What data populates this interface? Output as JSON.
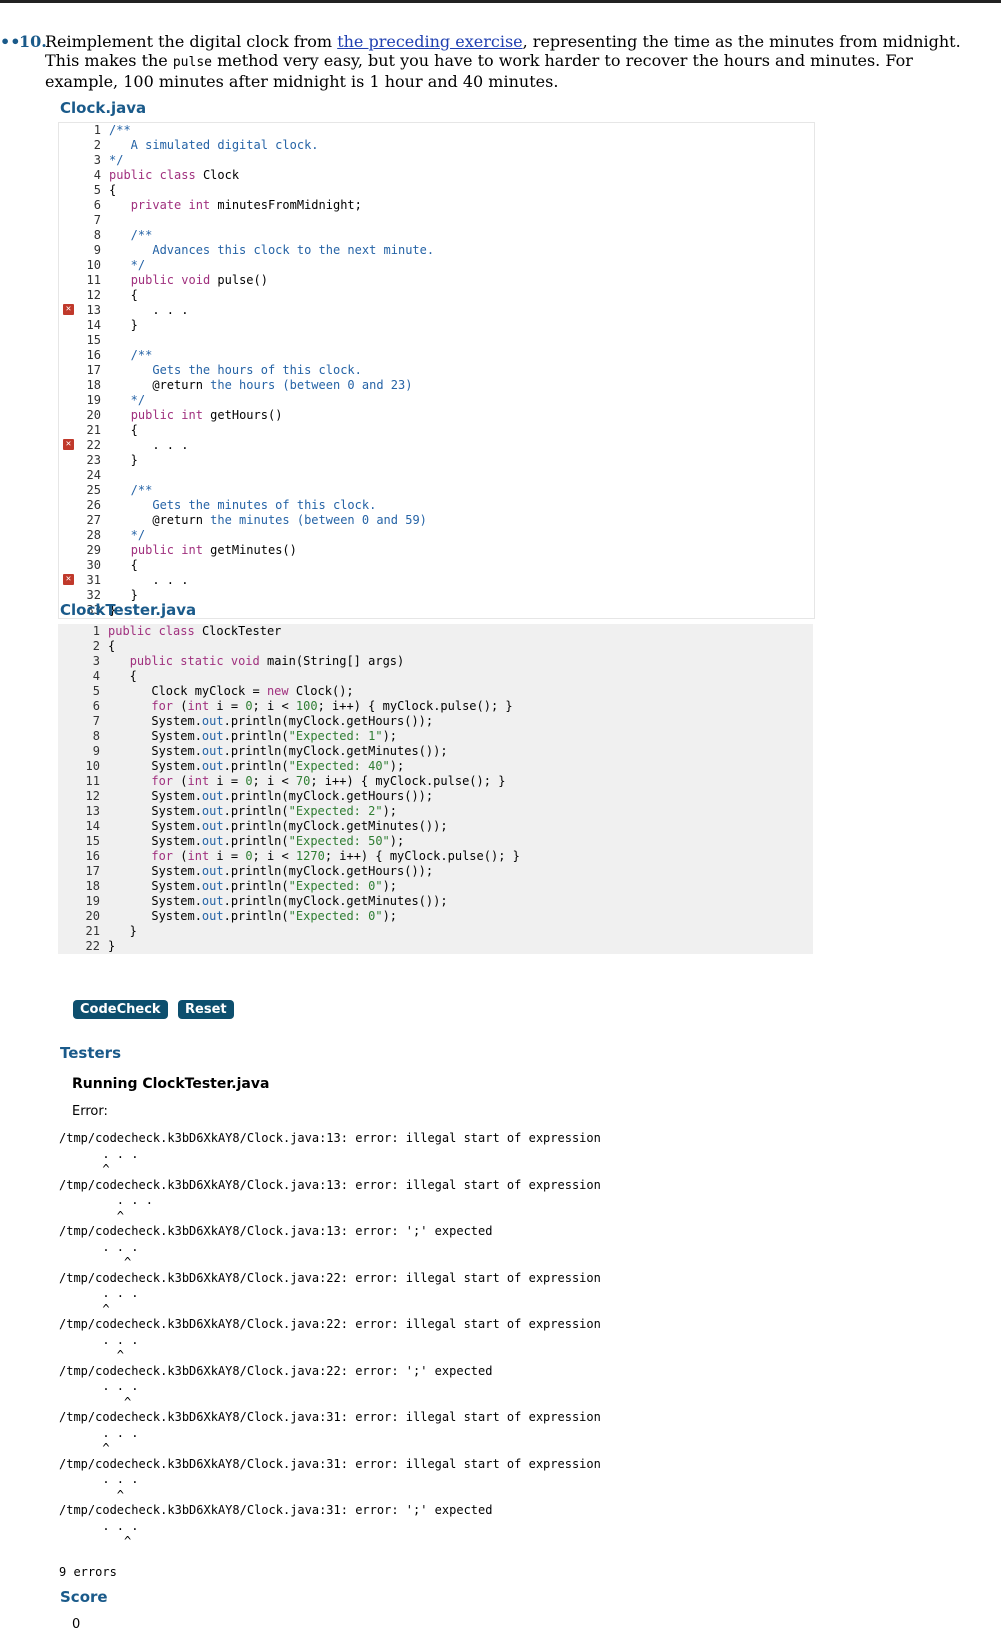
{
  "exercise": {
    "marker": "••",
    "number": "10.",
    "text_before_link": "Reimplement the digital clock from ",
    "link_text": "the preceding exercise",
    "text_after_link": ", representing the time as the minutes from midnight. This makes the ",
    "code_word": "pulse",
    "text_end": " method very easy, but you have to work harder to recover the hours and minutes. For example, 100 minutes after midnight is 1 hour and 40 minutes."
  },
  "files": [
    {
      "title": "Clock.java",
      "lines": [
        [
          {
            "t": "/**",
            "c": "cm"
          }
        ],
        [
          {
            "t": "   A simulated digital clock.",
            "c": "cm"
          }
        ],
        [
          {
            "t": "*/",
            "c": "cm"
          }
        ],
        [
          {
            "t": "public ",
            "c": "kw"
          },
          {
            "t": "class ",
            "c": "kw"
          },
          {
            "t": "Clock"
          }
        ],
        [
          {
            "t": "{"
          }
        ],
        [
          {
            "t": "   "
          },
          {
            "t": "private ",
            "c": "kw"
          },
          {
            "t": "int ",
            "c": "kw"
          },
          {
            "t": "minutesFromMidnight;"
          }
        ],
        [
          {
            "t": ""
          }
        ],
        [
          {
            "t": "   /**",
            "c": "cm"
          }
        ],
        [
          {
            "t": "      Advances this clock to the next minute.",
            "c": "cm"
          }
        ],
        [
          {
            "t": "   */",
            "c": "cm"
          }
        ],
        [
          {
            "t": "   "
          },
          {
            "t": "public ",
            "c": "kw"
          },
          {
            "t": "void ",
            "c": "kw"
          },
          {
            "t": "pulse()"
          }
        ],
        [
          {
            "t": "   {"
          }
        ],
        [
          {
            "t": "      . . ."
          }
        ],
        [
          {
            "t": "   }"
          }
        ],
        [
          {
            "t": ""
          }
        ],
        [
          {
            "t": "   /**",
            "c": "cm"
          }
        ],
        [
          {
            "t": "      Gets the hours of this clock.",
            "c": "cm"
          }
        ],
        [
          {
            "t": "      @return "
          },
          {
            "t": "the hours (between 0 and 23)",
            "c": "cm"
          }
        ],
        [
          {
            "t": "   */",
            "c": "cm"
          }
        ],
        [
          {
            "t": "   "
          },
          {
            "t": "public ",
            "c": "kw"
          },
          {
            "t": "int ",
            "c": "kw"
          },
          {
            "t": "getHours()"
          }
        ],
        [
          {
            "t": "   {"
          }
        ],
        [
          {
            "t": "      . . ."
          }
        ],
        [
          {
            "t": "   }"
          }
        ],
        [
          {
            "t": ""
          }
        ],
        [
          {
            "t": "   /**",
            "c": "cm"
          }
        ],
        [
          {
            "t": "      Gets the minutes of this clock.",
            "c": "cm"
          }
        ],
        [
          {
            "t": "      @return "
          },
          {
            "t": "the minutes (between 0 and 59)",
            "c": "cm"
          }
        ],
        [
          {
            "t": "   */",
            "c": "cm"
          }
        ],
        [
          {
            "t": "   "
          },
          {
            "t": "public ",
            "c": "kw"
          },
          {
            "t": "int ",
            "c": "kw"
          },
          {
            "t": "getMinutes()"
          }
        ],
        [
          {
            "t": "   {"
          }
        ],
        [
          {
            "t": "      . . ."
          }
        ],
        [
          {
            "t": "   }"
          }
        ],
        [
          {
            "t": "}"
          }
        ]
      ],
      "error_lines": [
        13,
        22,
        31
      ]
    },
    {
      "title": "ClockTester.java",
      "lines": [
        [
          {
            "t": "public ",
            "c": "kw"
          },
          {
            "t": "class ",
            "c": "kw"
          },
          {
            "t": "ClockTester"
          }
        ],
        [
          {
            "t": "{"
          }
        ],
        [
          {
            "t": "   "
          },
          {
            "t": "public ",
            "c": "kw"
          },
          {
            "t": "static ",
            "c": "kw"
          },
          {
            "t": "void ",
            "c": "kw"
          },
          {
            "t": "main(String[] args)"
          }
        ],
        [
          {
            "t": "   {"
          }
        ],
        [
          {
            "t": "      Clock myClock = "
          },
          {
            "t": "new ",
            "c": "kw"
          },
          {
            "t": "Clock();"
          }
        ],
        [
          {
            "t": "      "
          },
          {
            "t": "for ",
            "c": "kw"
          },
          {
            "t": "("
          },
          {
            "t": "int ",
            "c": "kw"
          },
          {
            "t": "i = "
          },
          {
            "t": "0",
            "c": "nu"
          },
          {
            "t": "; i < "
          },
          {
            "t": "100",
            "c": "nu"
          },
          {
            "t": "; i++) { myClock.pulse(); }"
          }
        ],
        [
          {
            "t": "      System."
          },
          {
            "t": "out",
            "c": "cm"
          },
          {
            "t": ".println(myClock.getHours());"
          }
        ],
        [
          {
            "t": "      System."
          },
          {
            "t": "out",
            "c": "cm"
          },
          {
            "t": ".println("
          },
          {
            "t": "\"Expected: 1\"",
            "c": "st"
          },
          {
            "t": ");"
          }
        ],
        [
          {
            "t": "      System."
          },
          {
            "t": "out",
            "c": "cm"
          },
          {
            "t": ".println(myClock.getMinutes());"
          }
        ],
        [
          {
            "t": "      System."
          },
          {
            "t": "out",
            "c": "cm"
          },
          {
            "t": ".println("
          },
          {
            "t": "\"Expected: 40\"",
            "c": "st"
          },
          {
            "t": ");"
          }
        ],
        [
          {
            "t": "      "
          },
          {
            "t": "for ",
            "c": "kw"
          },
          {
            "t": "("
          },
          {
            "t": "int ",
            "c": "kw"
          },
          {
            "t": "i = "
          },
          {
            "t": "0",
            "c": "nu"
          },
          {
            "t": "; i < "
          },
          {
            "t": "70",
            "c": "nu"
          },
          {
            "t": "; i++) { myClock.pulse(); }"
          }
        ],
        [
          {
            "t": "      System."
          },
          {
            "t": "out",
            "c": "cm"
          },
          {
            "t": ".println(myClock.getHours());"
          }
        ],
        [
          {
            "t": "      System."
          },
          {
            "t": "out",
            "c": "cm"
          },
          {
            "t": ".println("
          },
          {
            "t": "\"Expected: 2\"",
            "c": "st"
          },
          {
            "t": ");"
          }
        ],
        [
          {
            "t": "      System."
          },
          {
            "t": "out",
            "c": "cm"
          },
          {
            "t": ".println(myClock.getMinutes());"
          }
        ],
        [
          {
            "t": "      System."
          },
          {
            "t": "out",
            "c": "cm"
          },
          {
            "t": ".println("
          },
          {
            "t": "\"Expected: 50\"",
            "c": "st"
          },
          {
            "t": ");"
          }
        ],
        [
          {
            "t": "      "
          },
          {
            "t": "for ",
            "c": "kw"
          },
          {
            "t": "("
          },
          {
            "t": "int ",
            "c": "kw"
          },
          {
            "t": "i = "
          },
          {
            "t": "0",
            "c": "nu"
          },
          {
            "t": "; i < "
          },
          {
            "t": "1270",
            "c": "nu"
          },
          {
            "t": "; i++) { myClock.pulse(); }"
          }
        ],
        [
          {
            "t": "      System."
          },
          {
            "t": "out",
            "c": "cm"
          },
          {
            "t": ".println(myClock.getHours());"
          }
        ],
        [
          {
            "t": "      System."
          },
          {
            "t": "out",
            "c": "cm"
          },
          {
            "t": ".println("
          },
          {
            "t": "\"Expected: 0\"",
            "c": "st"
          },
          {
            "t": ");"
          }
        ],
        [
          {
            "t": "      System."
          },
          {
            "t": "out",
            "c": "cm"
          },
          {
            "t": ".println(myClock.getMinutes());"
          }
        ],
        [
          {
            "t": "      System."
          },
          {
            "t": "out",
            "c": "cm"
          },
          {
            "t": ".println("
          },
          {
            "t": "\"Expected: 0\"",
            "c": "st"
          },
          {
            "t": ");"
          }
        ],
        [
          {
            "t": "   }"
          }
        ],
        [
          {
            "t": "}"
          }
        ]
      ],
      "error_lines": []
    }
  ],
  "buttons": {
    "codecheck": "CodeCheck",
    "reset": "Reset"
  },
  "testers": {
    "heading": "Testers",
    "running": "Running ClockTester.java",
    "error_label": "Error:",
    "output": [
      "/tmp/codecheck.k3bD6XkAY8/Clock.java:13: error: illegal start of expression",
      "      . . .",
      "      ^",
      "/tmp/codecheck.k3bD6XkAY8/Clock.java:13: error: illegal start of expression",
      "        . . .",
      "        ^",
      "/tmp/codecheck.k3bD6XkAY8/Clock.java:13: error: ';' expected",
      "      . . .",
      "         ^",
      "/tmp/codecheck.k3bD6XkAY8/Clock.java:22: error: illegal start of expression",
      "      . . .",
      "      ^",
      "/tmp/codecheck.k3bD6XkAY8/Clock.java:22: error: illegal start of expression",
      "      . . .",
      "        ^",
      "/tmp/codecheck.k3bD6XkAY8/Clock.java:22: error: ';' expected",
      "      . . .",
      "         ^",
      "/tmp/codecheck.k3bD6XkAY8/Clock.java:31: error: illegal start of expression",
      "      . . .",
      "      ^",
      "/tmp/codecheck.k3bD6XkAY8/Clock.java:31: error: illegal start of expression",
      "      . . .",
      "        ^",
      "/tmp/codecheck.k3bD6XkAY8/Clock.java:31: error: ';' expected",
      "      . . .",
      "         ^",
      "",
      "9 errors"
    ]
  },
  "score": {
    "heading": "Score",
    "value": "0"
  }
}
